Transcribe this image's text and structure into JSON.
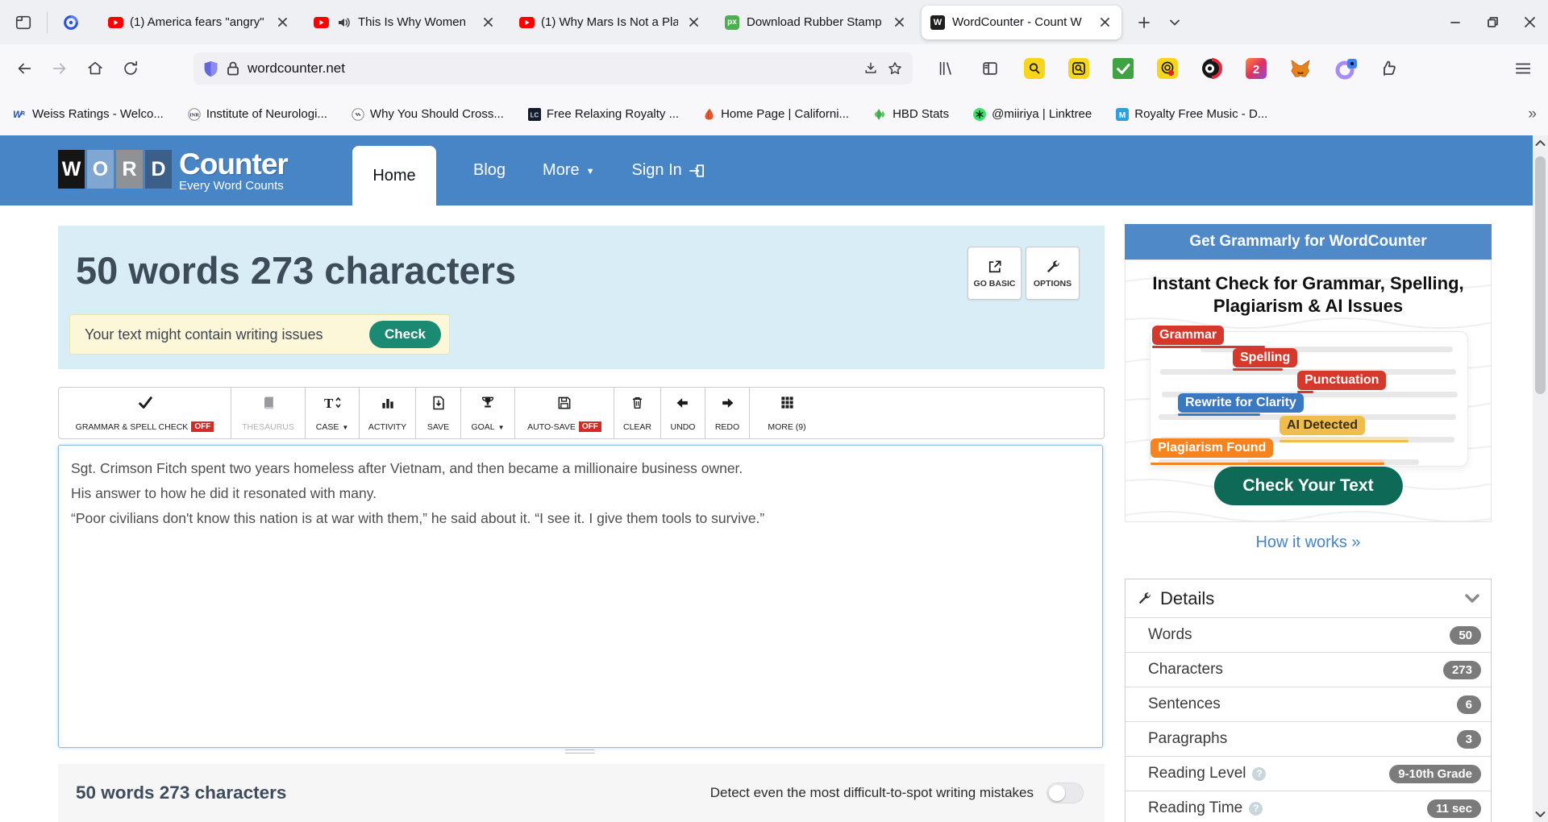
{
  "browser": {
    "tabs": [
      {
        "title": "(1) America fears \"angry\"",
        "favicon": "youtube"
      },
      {
        "title": "This Is Why Women",
        "favicon": "youtube",
        "audio": true
      },
      {
        "title": "(1) Why Mars Is Not a Pla",
        "favicon": "youtube"
      },
      {
        "title": "Download Rubber Stamp",
        "favicon": "px",
        "favicon_text": "px"
      },
      {
        "title": "WordCounter - Count W",
        "favicon": "wordcounter",
        "favicon_text": "W",
        "active": true
      }
    ],
    "url": "wordcounter.net",
    "ext_badge": "2",
    "bookmarks": [
      {
        "label": "Weiss Ratings - Welco...",
        "icon": "weiss",
        "icon_text": "WR"
      },
      {
        "label": "Institute of Neurologi...",
        "icon": "inr-circle",
        "icon_text": "INR"
      },
      {
        "label": "Why You Should Cross...",
        "icon": "wave-circle"
      },
      {
        "label": "Free Relaxing Royalty ...",
        "icon": "lc-dark",
        "icon_text": "LC"
      },
      {
        "label": "Home Page | Californi...",
        "icon": "poppy"
      },
      {
        "label": "HBD Stats",
        "icon": "hive-green"
      },
      {
        "label": "@miiriya | Linktree",
        "icon": "linktree",
        "icon_text": "*"
      },
      {
        "label": "Royalty Free Music - D...",
        "icon": "m-blue",
        "icon_text": "M"
      }
    ]
  },
  "site": {
    "logo": {
      "letters": [
        "W",
        "O",
        "R",
        "D"
      ],
      "name": "Counter",
      "tagline": "Every Word Counts"
    },
    "nav": {
      "home": "Home",
      "blog": "Blog",
      "more": "More",
      "signin": "Sign In"
    }
  },
  "hero": {
    "title": "50 words 273 characters",
    "go_basic": "GO BASIC",
    "options": "OPTIONS",
    "banner_text": "Your text might contain writing issues",
    "banner_button": "Check"
  },
  "toolbar": {
    "buttons": [
      {
        "label": "GRAMMAR & SPELL CHECK",
        "badge": "OFF"
      },
      {
        "label": "THESAURUS",
        "disabled": true
      },
      {
        "label": "CASE",
        "dropdown": true
      },
      {
        "label": "ACTIVITY"
      },
      {
        "label": "SAVE"
      },
      {
        "label": "GOAL",
        "dropdown": true
      },
      {
        "label": "AUTO-SAVE",
        "badge": "OFF"
      },
      {
        "label": "CLEAR"
      },
      {
        "label": "UNDO"
      },
      {
        "label": "REDO"
      },
      {
        "label": "MORE (9)"
      }
    ]
  },
  "editor": {
    "lines": [
      "Sgt. Crimson Fitch spent two years homeless after Vietnam, and then became a millionaire business owner.",
      "His answer to how he did it resonated with many.",
      "“Poor civilians don't know this nation is at war with them,” he said about it. “I see it. I give them tools to survive.”"
    ]
  },
  "footer": {
    "stats": "50 words 273 characters",
    "detect_label": "Detect even the most difficult-to-spot writing mistakes"
  },
  "sidebar": {
    "ad": {
      "header": "Get Grammarly for WordCounter",
      "headline": "Instant Check for Grammar, Spelling, Plagiarism & AI Issues",
      "badges": [
        "Grammar",
        "Spelling",
        "Punctuation",
        "Rewrite for Clarity",
        "AI Detected",
        "Plagiarism Found"
      ],
      "cta": "Check Your Text",
      "link": "How it works »"
    },
    "details": {
      "title": "Details",
      "rows": [
        {
          "label": "Words",
          "value": "50"
        },
        {
          "label": "Characters",
          "value": "273"
        },
        {
          "label": "Sentences",
          "value": "6"
        },
        {
          "label": "Paragraphs",
          "value": "3"
        },
        {
          "label": "Reading Level",
          "value": "9-10th Grade",
          "help": true
        },
        {
          "label": "Reading Time",
          "value": "11 sec",
          "help": true
        }
      ]
    }
  },
  "colors": {
    "brand_blue": "#4885c7",
    "hero_bg": "#d9edf7",
    "banner_bg": "#fdf7da",
    "check_teal": "#1b8a73",
    "cta_green": "#0e6a57",
    "badge_red": "#d4392c",
    "badge_blue": "#3a78c2",
    "badge_amber": "#efbd4d",
    "badge_orange": "#f5831f",
    "off_red": "#d32b25",
    "pill_gray": "#7b7b7b"
  }
}
